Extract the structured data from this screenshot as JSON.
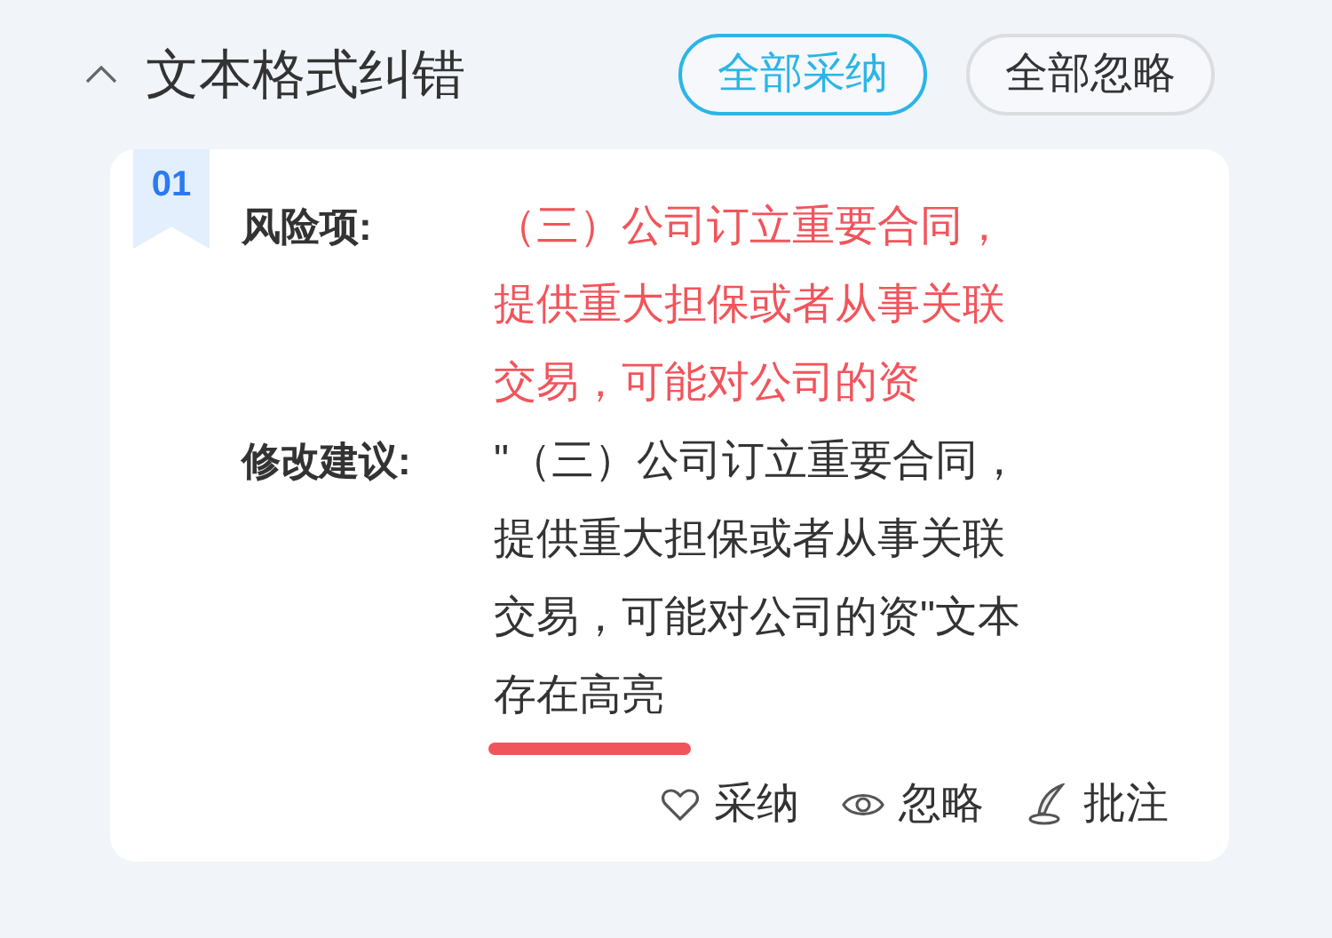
{
  "section": {
    "title": "文本格式纠错",
    "expanded": true
  },
  "buttons": [
    {
      "label": "全部采纳",
      "kind": "primary"
    },
    {
      "label": "全部忽略",
      "kind": "default"
    }
  ],
  "items": [
    {
      "index": "01",
      "risk_label": "风险项:",
      "risk_text": "（三）公司订立重要合同，提供重大担保或者从事关联交易，可能对公司的资",
      "suggestion_label": "修改建议:",
      "suggestion_text": "\"（三）公司订立重要合同，提供重大担保或者从事关联交易，可能对公司的资\"文本存在高亮",
      "actions": [
        {
          "label": "采纳",
          "kind": "adopt"
        },
        {
          "label": "忽略",
          "kind": "ignore"
        },
        {
          "label": "批注",
          "kind": "comment"
        }
      ]
    }
  ]
}
